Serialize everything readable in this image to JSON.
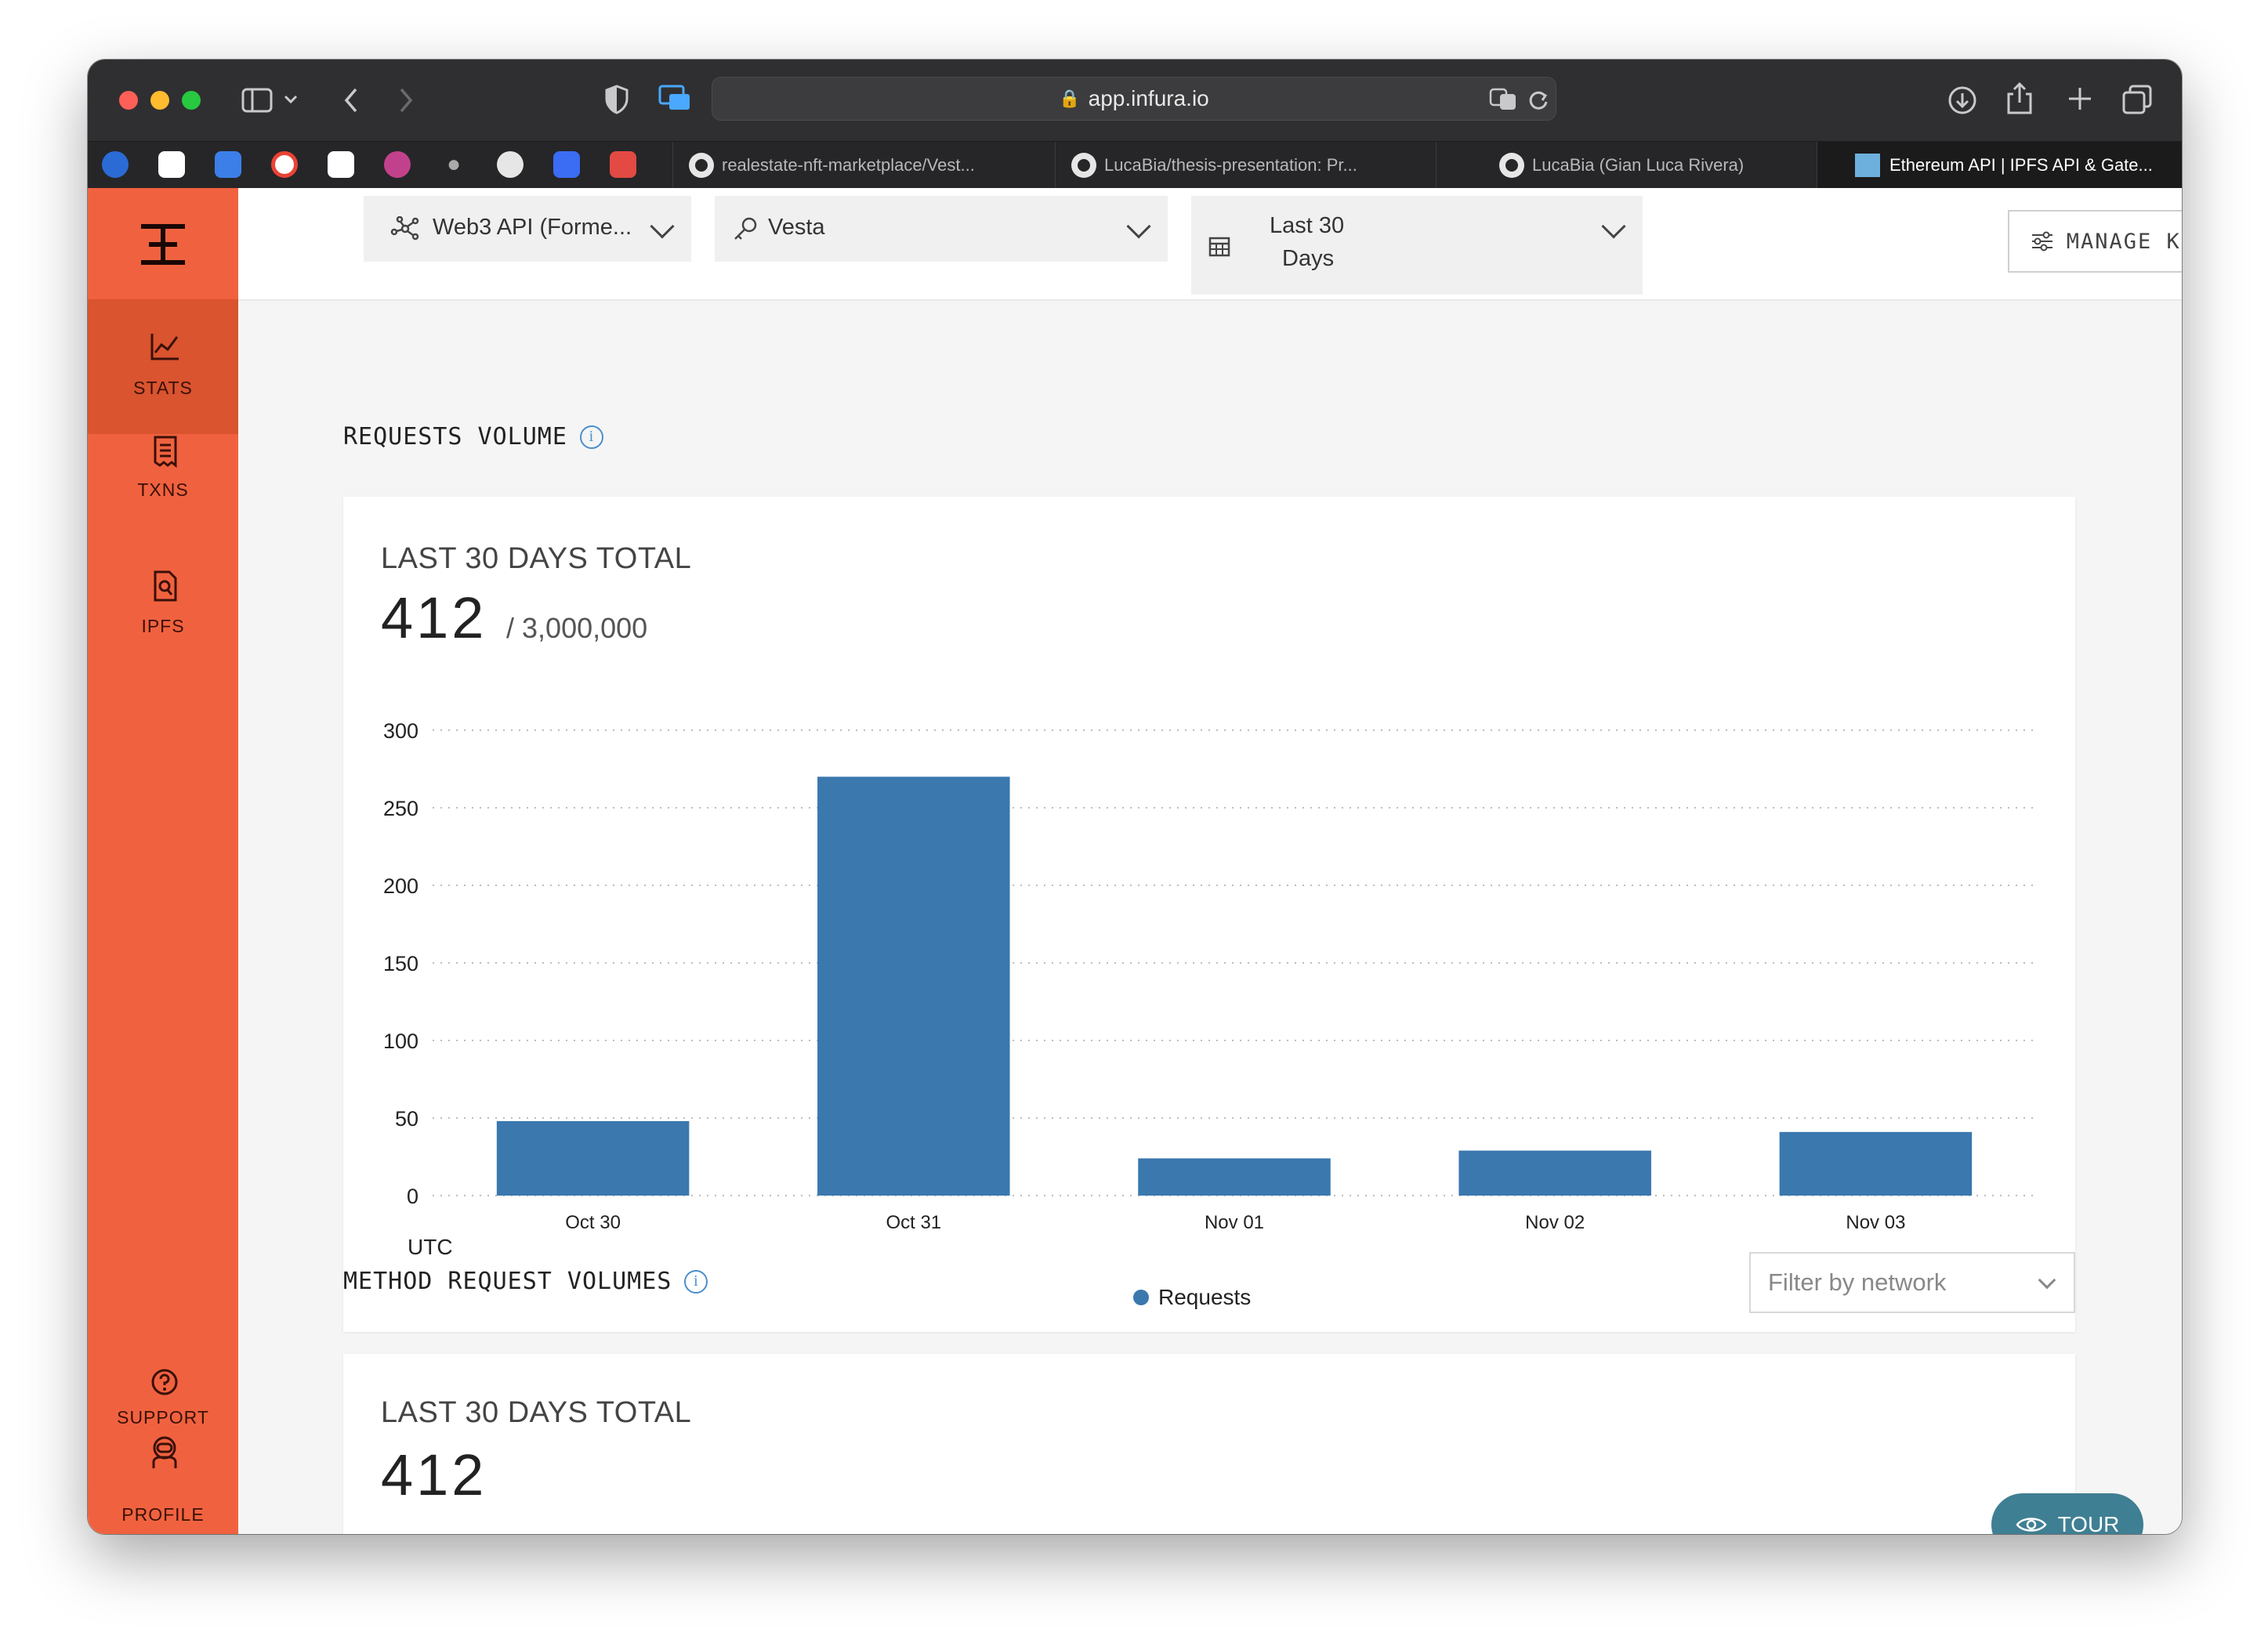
{
  "browser": {
    "url": "app.infura.io",
    "tabs": [
      {
        "title": "realestate-nft-marketplace/Vest..."
      },
      {
        "title": "LucaBia/thesis-presentation: Pr..."
      },
      {
        "title": "LucaBia (Gian Luca Rivera)"
      },
      {
        "title": "Ethereum API | IPFS API & Gate..."
      }
    ]
  },
  "sidebar": {
    "items": [
      {
        "label": "STATS",
        "icon": "chart-line-icon"
      },
      {
        "label": "TXNS",
        "icon": "receipt-icon"
      },
      {
        "label": "IPFS",
        "icon": "file-search-icon"
      },
      {
        "label": "SUPPORT",
        "icon": "question-circle-icon"
      },
      {
        "label": "PROFILE",
        "icon": "astronaut-icon"
      }
    ]
  },
  "topbar": {
    "network_select": "Web3 API (Forme...",
    "key_select": "Vesta",
    "range_line1": "Last 30",
    "range_line2": "Days",
    "manage_key": "MANAGE KEY"
  },
  "requests_section": {
    "title": "REQUESTS VOLUME",
    "card_label": "LAST 30 DAYS TOTAL",
    "total": "412",
    "quota": "/ 3,000,000",
    "timezone": "UTC"
  },
  "chart_data": {
    "type": "bar",
    "categories": [
      "Oct 30",
      "Oct 31",
      "Nov 01",
      "Nov 02",
      "Nov 03"
    ],
    "series": [
      {
        "name": "Requests",
        "values": [
          48,
          270,
          24,
          29,
          41
        ],
        "color": "#3a78ae"
      }
    ],
    "ylim": [
      0,
      300
    ],
    "yticks": [
      0,
      50,
      100,
      150,
      200,
      250,
      300
    ],
    "grid": true,
    "legend": "bottom-center"
  },
  "methods_section": {
    "title": "METHOD REQUEST VOLUMES",
    "filter_placeholder": "Filter by network",
    "card_label": "LAST 30 DAYS TOTAL",
    "total": "412"
  },
  "tour_label": "TOUR"
}
